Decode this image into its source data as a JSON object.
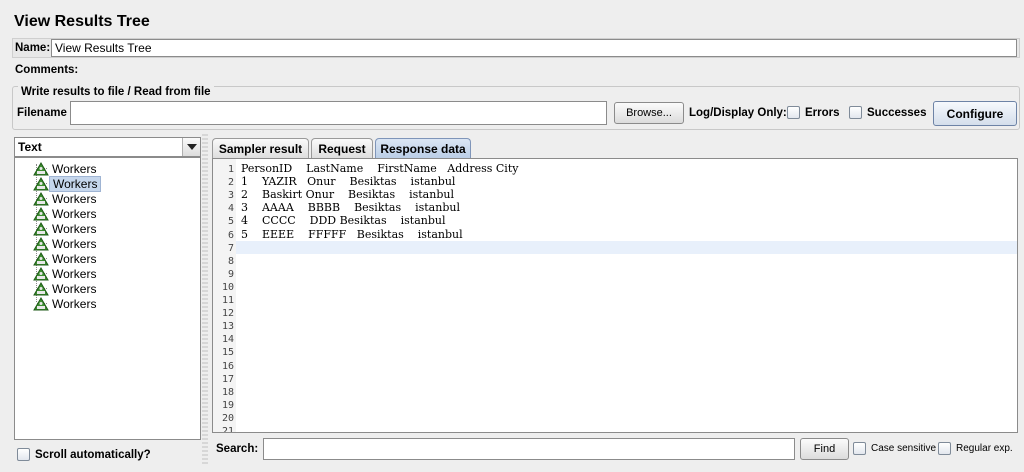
{
  "title": "View Results Tree",
  "name": {
    "label": "Name:",
    "value": "View Results Tree"
  },
  "comments": {
    "label": "Comments:"
  },
  "file_group": {
    "title": "Write results to file / Read from file",
    "filename_label": "Filename",
    "filename_value": "",
    "browse_label": "Browse...",
    "log_display_label": "Log/Display Only:",
    "errors_label": "Errors",
    "successes_label": "Successes",
    "configure_label": "Configure"
  },
  "renderer": {
    "selected": "Text"
  },
  "tree": {
    "items": [
      "Workers",
      "Workers",
      "Workers",
      "Workers",
      "Workers",
      "Workers",
      "Workers",
      "Workers",
      "Workers",
      "Workers"
    ],
    "selected_index": 1
  },
  "scroll_auto_label": "Scroll automatically?",
  "tabs": [
    "Sampler result",
    "Request",
    "Response data"
  ],
  "active_tab": "Response data",
  "response_lines": [
    "PersonID    LastName    FirstName   Address City",
    "1    YAZIR   Onur    Besiktas    istanbul",
    "2    Baskirt Onur    Besiktas    istanbul",
    "3    AAAA    BBBB    Besiktas    istanbul",
    "4    CCCC    DDD Besiktas    istanbul",
    "5    EEEE    FFFFF   Besiktas    istanbul",
    ""
  ],
  "line_numbers": [
    "1",
    "2",
    "3",
    "4",
    "5",
    "6",
    "7",
    "8",
    "9",
    "10",
    "11",
    "12",
    "13",
    "14",
    "15",
    "16",
    "17",
    "18",
    "19",
    "20",
    "21"
  ],
  "current_line": 7,
  "search": {
    "label": "Search:",
    "value": "",
    "find_label": "Find",
    "case_sensitive_label": "Case sensitive",
    "regex_label": "Regular exp."
  },
  "colors": {
    "selection": "#c5d6ec",
    "active_tab": "#b9cde6"
  }
}
